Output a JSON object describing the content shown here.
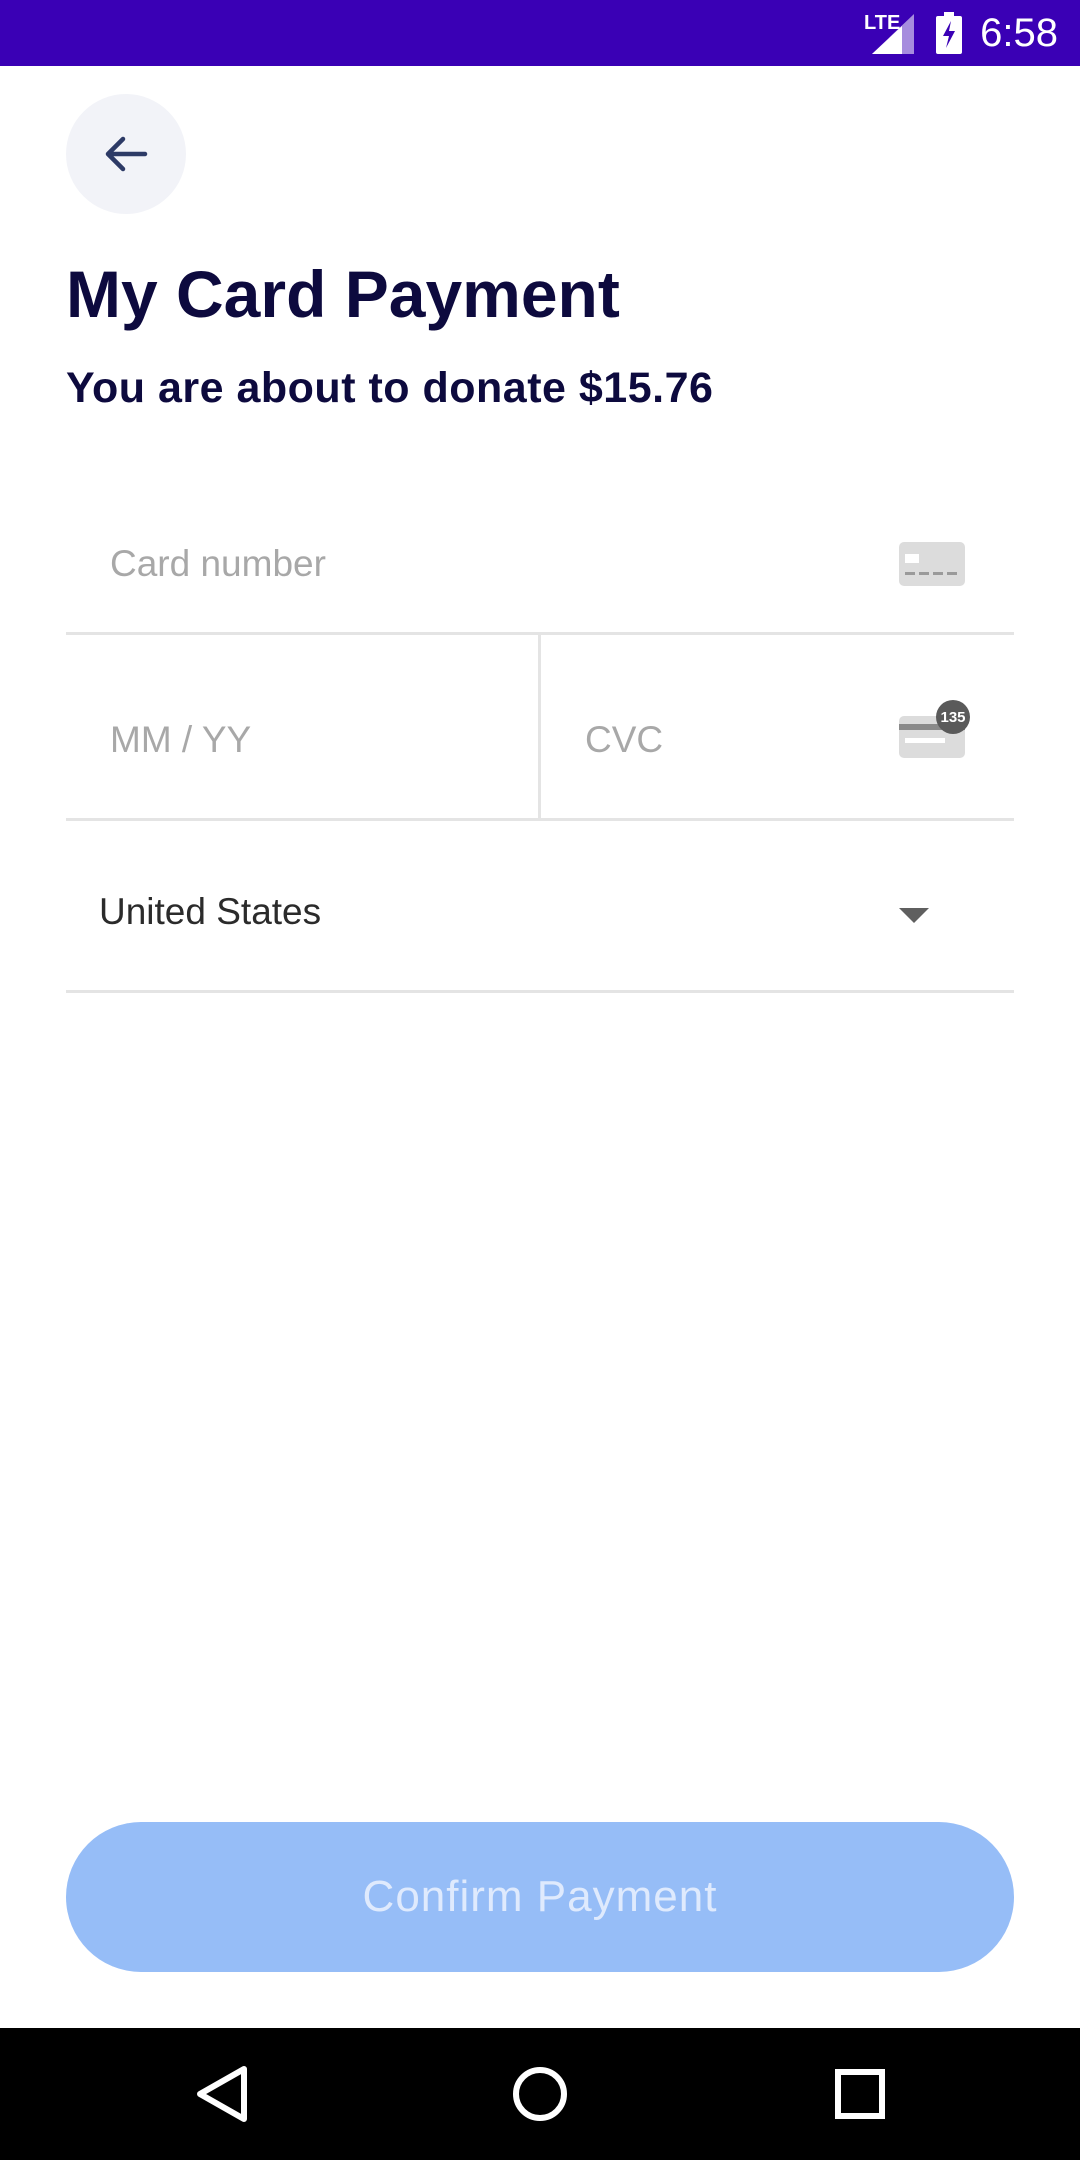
{
  "status_bar": {
    "network": "LTE",
    "time": "6:58"
  },
  "header": {
    "back_icon": "arrow-left-icon",
    "title": "My Card Payment",
    "subtitle": "You are about to donate $15.76"
  },
  "form": {
    "card_number_placeholder": "Card number",
    "expiry_placeholder": "MM / YY",
    "cvc_placeholder": "CVC",
    "cvc_badge": "135",
    "country": "United States"
  },
  "actions": {
    "confirm_label": "Confirm Payment"
  },
  "colors": {
    "status_bar": "#3a00b5",
    "title": "#0d0a3e",
    "confirm_button_disabled": "#96bdf7"
  },
  "nav_bar": {
    "icons": [
      "back-triangle-icon",
      "home-circle-icon",
      "recents-square-icon"
    ]
  }
}
